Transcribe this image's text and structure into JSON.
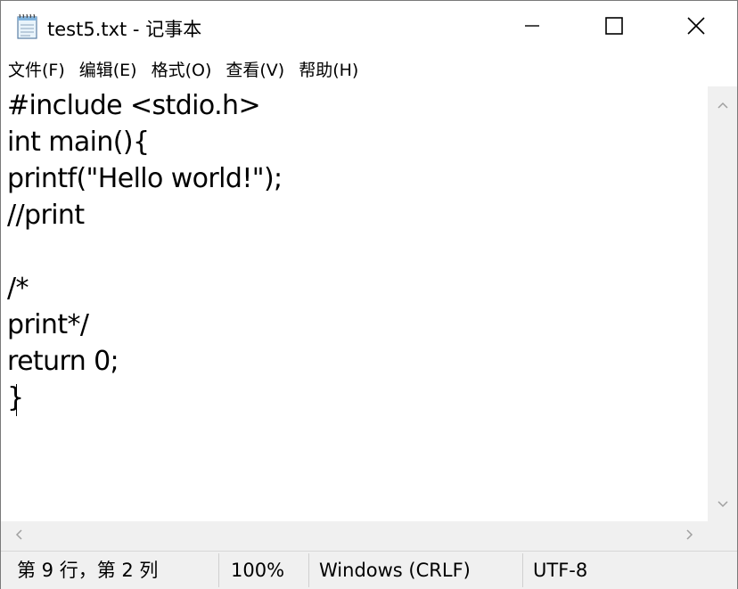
{
  "window": {
    "title": "test5.txt - 记事本"
  },
  "icons": {
    "app": "notepad-icon",
    "minimize": "minimize-icon",
    "maximize": "maximize-icon",
    "close": "close-icon",
    "scroll_up": "chevron-up-icon",
    "scroll_down": "chevron-down-icon",
    "scroll_left": "chevron-left-icon",
    "scroll_right": "chevron-right-icon"
  },
  "menu": {
    "items": [
      {
        "label": "文件(F)"
      },
      {
        "label": "编辑(E)"
      },
      {
        "label": "格式(O)"
      },
      {
        "label": "查看(V)"
      },
      {
        "label": "帮助(H)"
      }
    ]
  },
  "editor": {
    "lines": [
      "#include <stdio.h>",
      "int main(){",
      "printf(\"Hello world!\");",
      "//print",
      "",
      "/*",
      "print*/",
      "return 0;",
      "}"
    ]
  },
  "status": {
    "position": "第 9 行，第 2 列",
    "zoom": "100%",
    "line_ending": "Windows (CRLF)",
    "encoding": "UTF-8"
  },
  "colors": {
    "chrome": "#f0f0f0",
    "text": "#000000",
    "background": "#ffffff"
  }
}
